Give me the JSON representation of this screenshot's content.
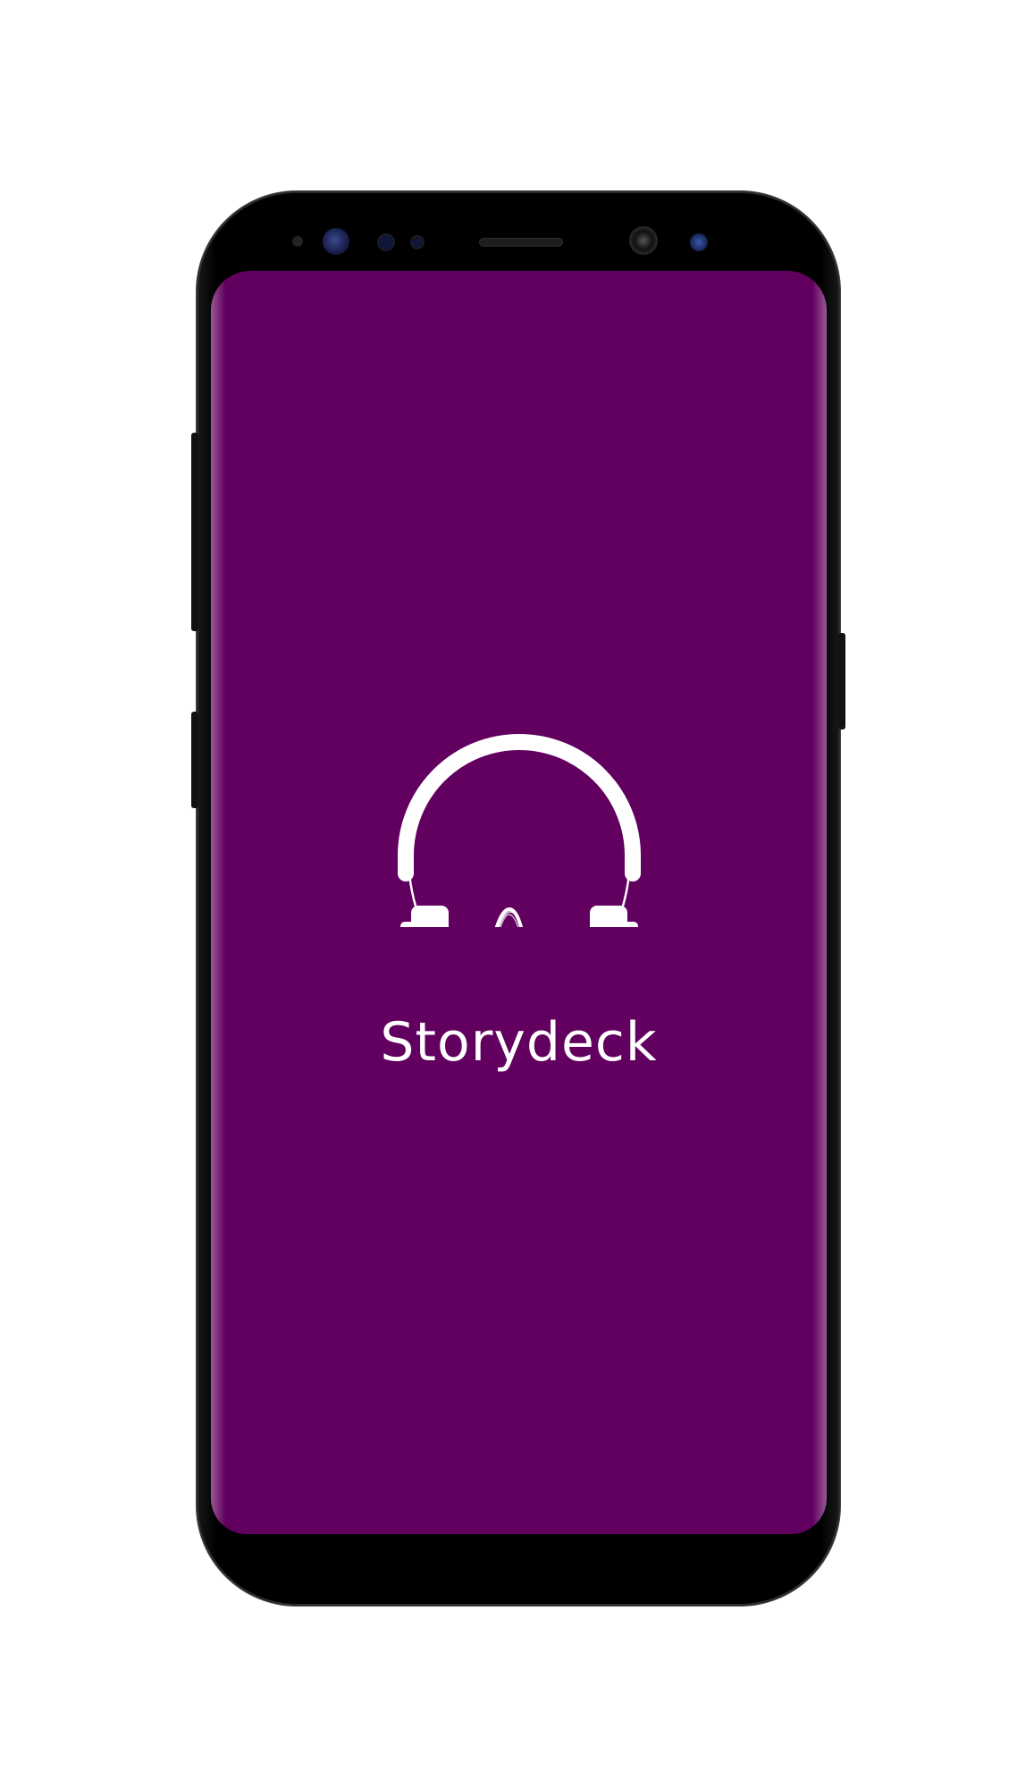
{
  "app": {
    "name": "Storydeck"
  },
  "theme": {
    "background": "#62005f",
    "foreground": "#ffffff"
  },
  "splash": {
    "logo_icon": "headphones-soundwave-icon"
  }
}
